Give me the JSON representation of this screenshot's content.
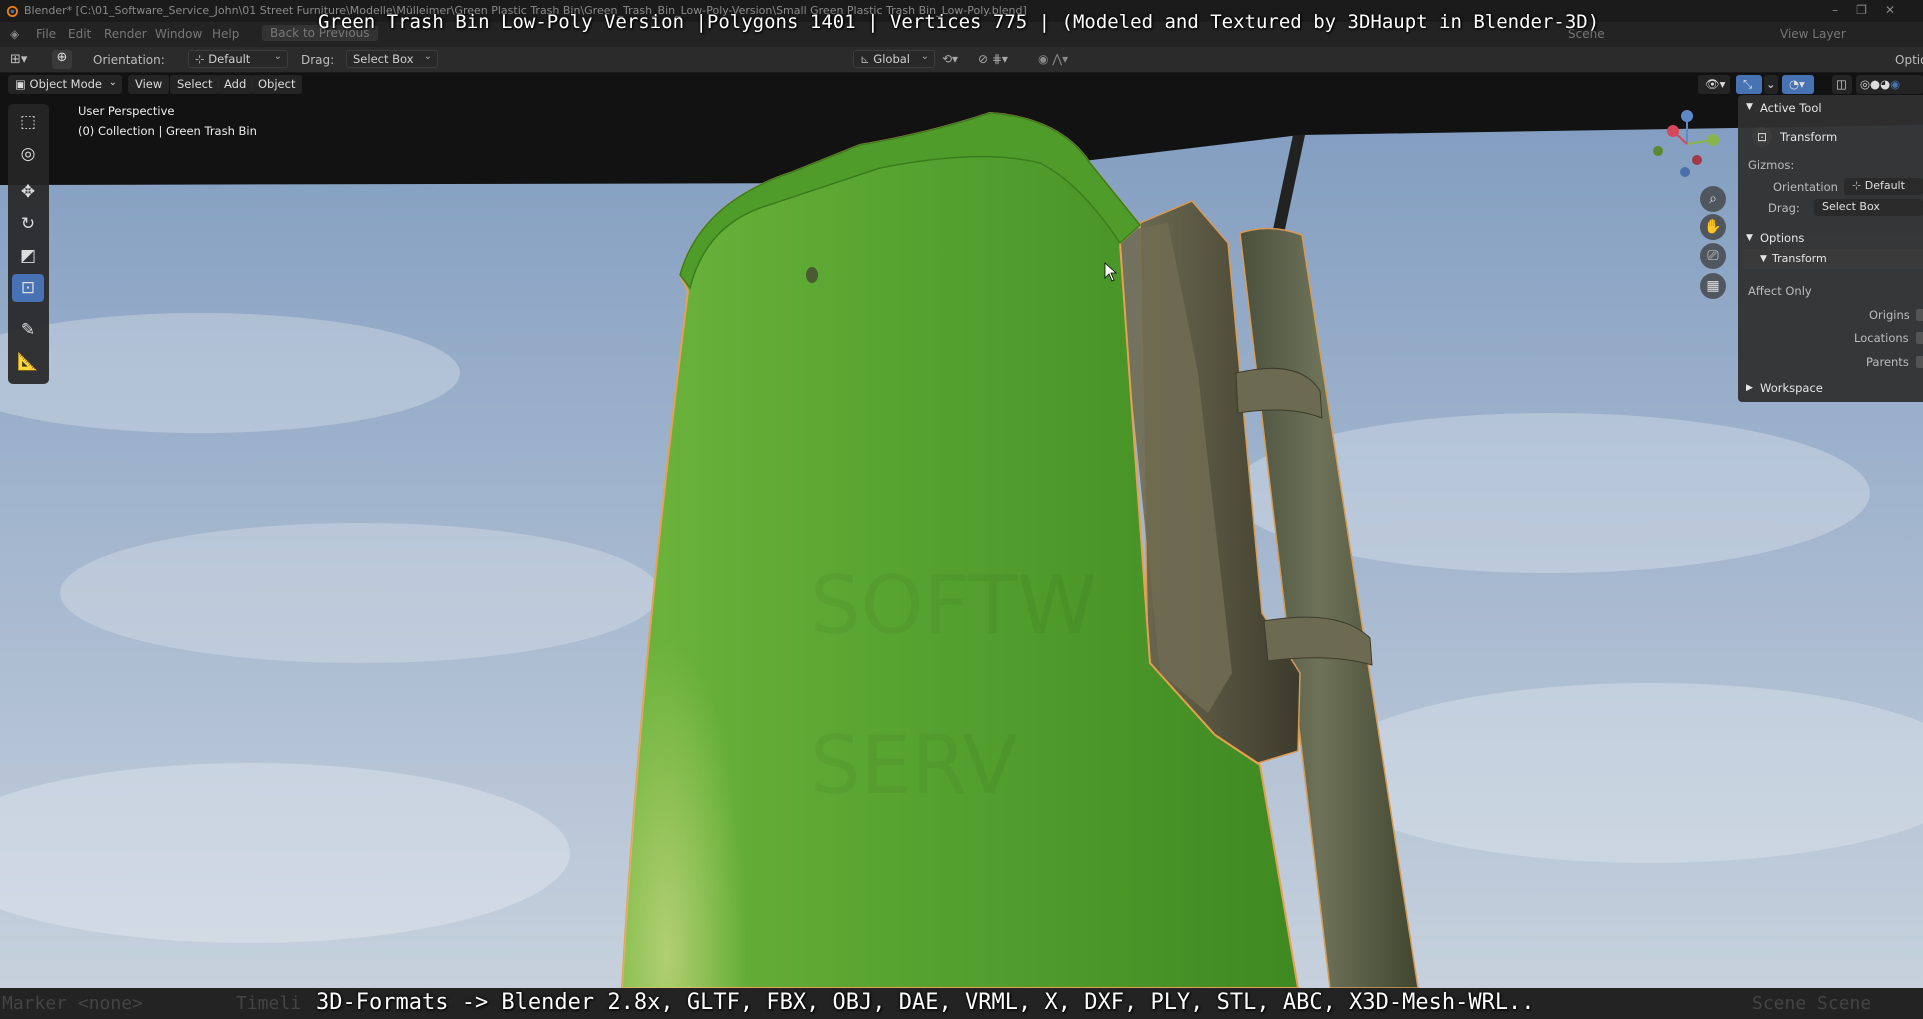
{
  "window": {
    "title": "Blender* [C:\\01_Software_Service_John\\01 Street Furniture\\Modelle\\Mülleimer\\Green Plastic Trash Bin\\Green_Trash_Bin_Low-Poly-Version\\Small Green Plastic Trash Bin_Low-Poly.blend]",
    "controls": [
      "–",
      "❐",
      "✕"
    ]
  },
  "captions": {
    "top": "Green Trash Bin Low-Poly Version |Polygons 1401 | Vertices 775 | (Modeled and Textured by 3DHaupt in Blender-3D)",
    "bottom": "3D-Formats -> Blender 2.8x, GLTF, FBX, OBJ, DAE, VRML, X, DXF, PLY, STL, ABC, X3D-Mesh-WRL.."
  },
  "menubar": {
    "items": [
      "File",
      "Edit",
      "Render",
      "Window",
      "Help"
    ],
    "back_to_previous": "Back to Previous",
    "scene": "Scene",
    "view_layer": "View Layer"
  },
  "tool_header": {
    "orientation_label": "Orientation:",
    "orientation_value": "Default",
    "drag_label": "Drag:",
    "drag_value": "Select Box",
    "transform_orientation": "Global",
    "options_label": "Optio"
  },
  "viewport_header": {
    "mode": "Object Mode",
    "menus": [
      "View",
      "Select",
      "Add",
      "Object"
    ]
  },
  "viewport": {
    "perspective_label": "User Perspective",
    "collection_label": "(0) Collection | Green Trash Bin",
    "colors": {
      "bin_green": "#5aa632",
      "bin_dark_green": "#3e8a22",
      "bracket": "#5c5a44",
      "pole": "#585e48",
      "selection_outline": "#e8a050",
      "sky_top": "#7f9bbf",
      "sky_bottom": "#c7d1dd"
    }
  },
  "tools": [
    "select-box",
    "cursor",
    "move",
    "rotate",
    "scale",
    "transform",
    "annotate",
    "measure"
  ],
  "npanel": {
    "active_tool_header": "Active Tool",
    "tool_name": "Transform",
    "gizmos_label": "Gizmos:",
    "orientation_label": "Orientation",
    "orientation_value": "Default",
    "drag_label": "Drag:",
    "drag_value": "Select Box",
    "options_header": "Options",
    "transform_sub": "Transform",
    "affect_only_label": "Affect Only",
    "affect_items": [
      "Origins",
      "Locations",
      "Parents"
    ],
    "workspace_header": "Workspace"
  },
  "statusbar": {
    "left": "Marker <none>",
    "mid": "Timeli",
    "right": "Scene Scene"
  }
}
